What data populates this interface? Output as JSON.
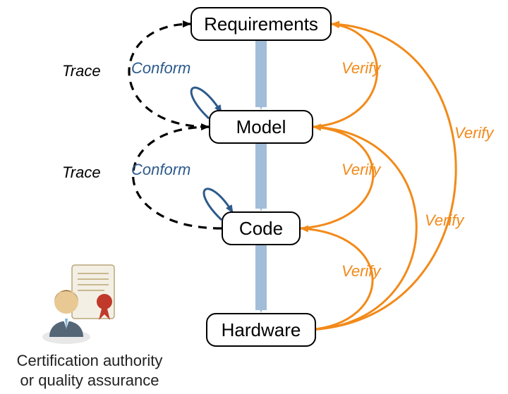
{
  "nodes": {
    "requirements": "Requirements",
    "model": "Model",
    "code": "Code",
    "hardware": "Hardware"
  },
  "edges": {
    "trace1": "Trace",
    "trace2": "Trace",
    "conform1": "Conform",
    "conform2": "Conform",
    "verify_model_req": "Verify",
    "verify_code_model": "Verify",
    "verify_hw_code": "Verify",
    "verify_hw_model": "Verify",
    "verify_hw_req": "Verify"
  },
  "caption": {
    "line1": "Certification authority",
    "line2": "or quality assurance"
  },
  "colors": {
    "flow": "#a2bdd9",
    "conform": "#2d5a8c",
    "verify": "#f28a1a",
    "trace": "#000000"
  }
}
